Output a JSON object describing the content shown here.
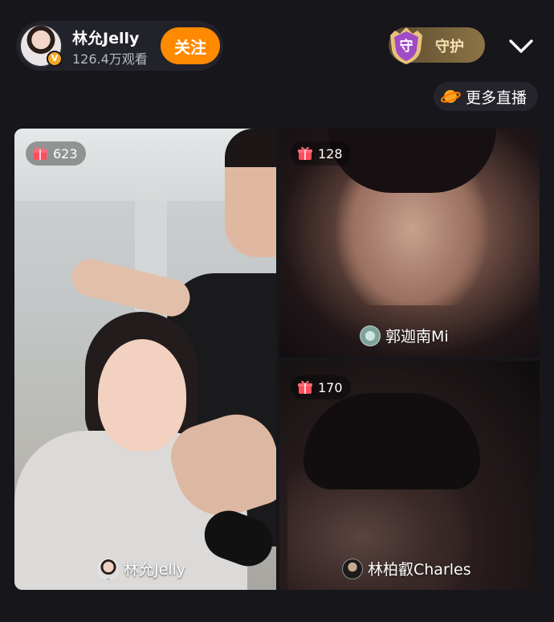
{
  "header": {
    "host_name": "林允Jelly",
    "host_views": "126.4万观看",
    "follow_label": "关注",
    "guard_label": "守护",
    "guard_badge_char": "守",
    "avatar_badge": "V"
  },
  "more_live": {
    "label": "更多直播"
  },
  "tiles": [
    {
      "gift_count": "623",
      "name": "林允Jelly"
    },
    {
      "gift_count": "128",
      "name": "郭迦南Mi"
    },
    {
      "gift_count": "170",
      "name": "林柏叡Charles"
    }
  ],
  "colors": {
    "background": "#16161b",
    "follow_button": "#ff8a00",
    "guard_button": "#8d7445",
    "guard_shield": "#a04cc6",
    "gift_icon": "#ff4d5e"
  },
  "icons": {
    "guard": "shield-icon",
    "collapse": "chevron-down-icon",
    "more_live": "planet-icon",
    "gift": "gift-icon"
  }
}
